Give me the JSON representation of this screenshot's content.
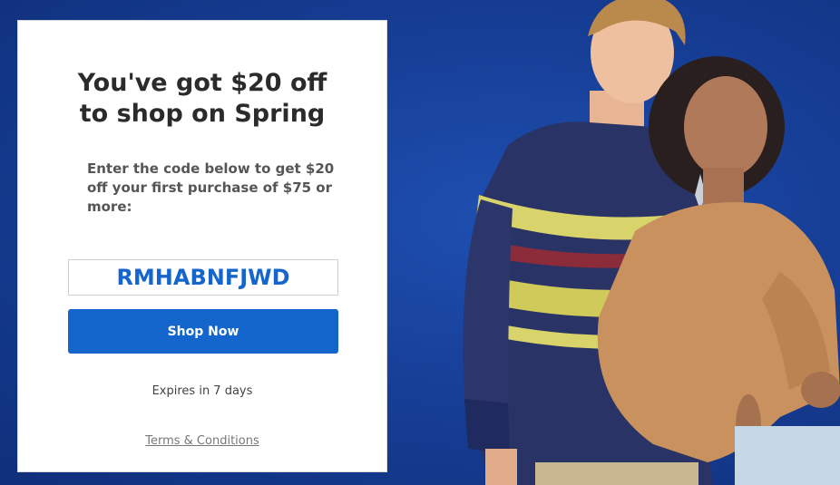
{
  "offer": {
    "headline_line1": "You've got $20 off",
    "headline_line2": "to shop on Spring",
    "intro": "Enter the code below to get $20 off your first purchase of $75 or more:",
    "promo_code": "RMHABNFJWD",
    "shop_button_label": "Shop Now",
    "expires_text": "Expires in 7 days",
    "terms_link": "Terms & Conditions"
  },
  "colors": {
    "background": "#163c8f",
    "accent": "#1466cc",
    "headline": "#2b2b2b"
  },
  "hero_image": {
    "icon": "models-photo"
  }
}
